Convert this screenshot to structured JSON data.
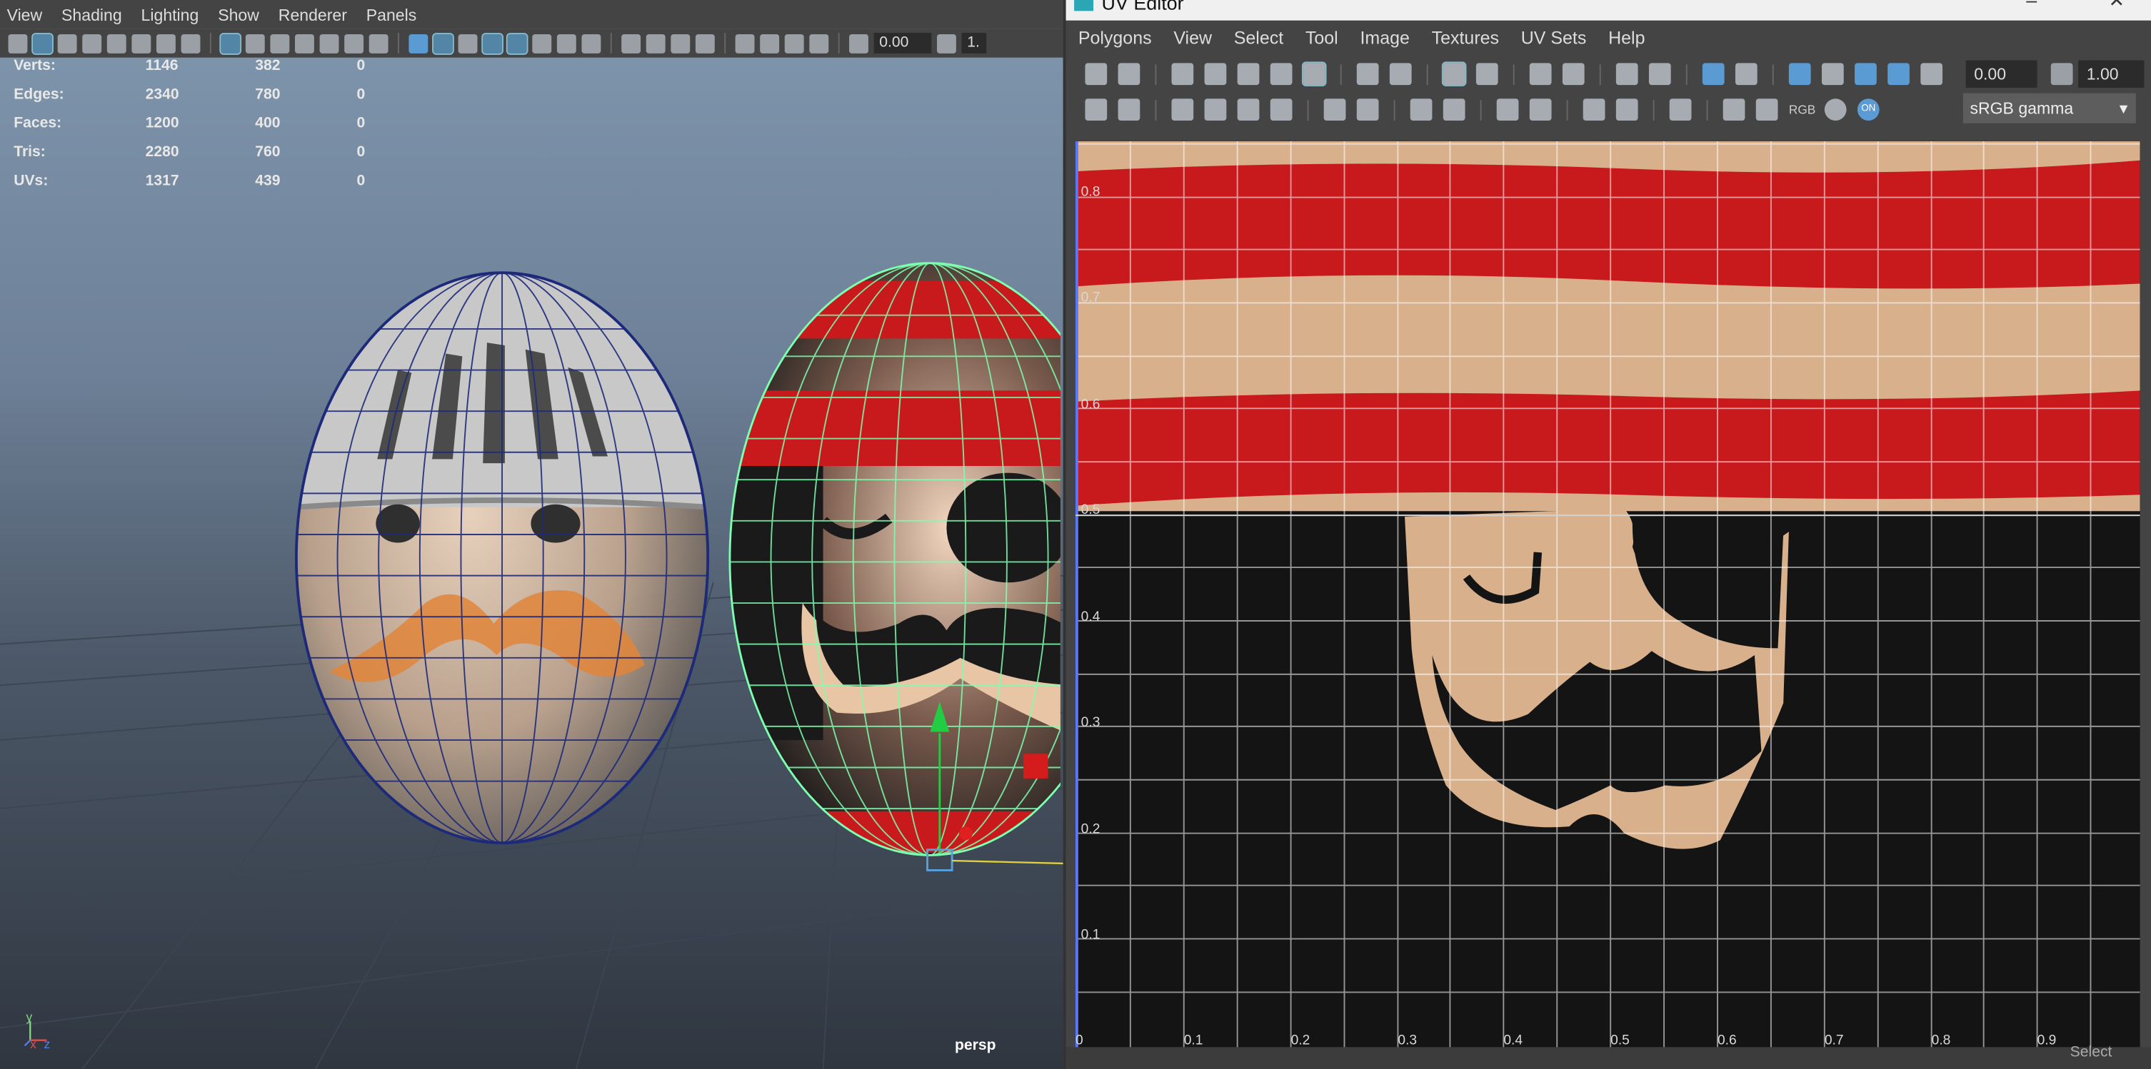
{
  "viewport": {
    "menu": [
      "View",
      "Shading",
      "Lighting",
      "Show",
      "Renderer",
      "Panels"
    ],
    "toolbar_value": "0.00",
    "toolbar_value_partial": "1.",
    "hud": [
      {
        "label": "Verts:",
        "a": "1146",
        "b": "382",
        "c": "0"
      },
      {
        "label": "Edges:",
        "a": "2340",
        "b": "780",
        "c": "0"
      },
      {
        "label": "Faces:",
        "a": "1200",
        "b": "400",
        "c": "0"
      },
      {
        "label": "Tris:",
        "a": "2280",
        "b": "760",
        "c": "0"
      },
      {
        "label": "UVs:",
        "a": "1317",
        "b": "439",
        "c": "0"
      }
    ],
    "camera": "persp",
    "axis": {
      "y": "y",
      "x": "x",
      "z": "z"
    }
  },
  "uv_editor": {
    "title": "UV Editor",
    "menu": [
      "Polygons",
      "View",
      "Select",
      "Tool",
      "Image",
      "Textures",
      "UV Sets",
      "Help"
    ],
    "field_1": "0.00",
    "field_2": "1.00",
    "color_space": "sRGB gamma",
    "rgb_label": "RGB",
    "on_label": "ON",
    "v_labels": [
      "0.8",
      "0.7",
      "0.6",
      "0.5",
      "0.4",
      "0.3",
      "0.2",
      "0.1",
      "0"
    ],
    "u_labels": [
      "0",
      "0.1",
      "0.2",
      "0.3",
      "0.4",
      "0.5",
      "0.6",
      "0.7",
      "0.8",
      "0.9"
    ],
    "status": "Select"
  },
  "colors": {
    "panel": "#444444",
    "selection_wire": "#7dffb0",
    "stripe_red": "#c8191c",
    "skin": "#d9b08c",
    "mustache_orange": "#e0853a",
    "highlight_blue": "#5a9bd4"
  }
}
